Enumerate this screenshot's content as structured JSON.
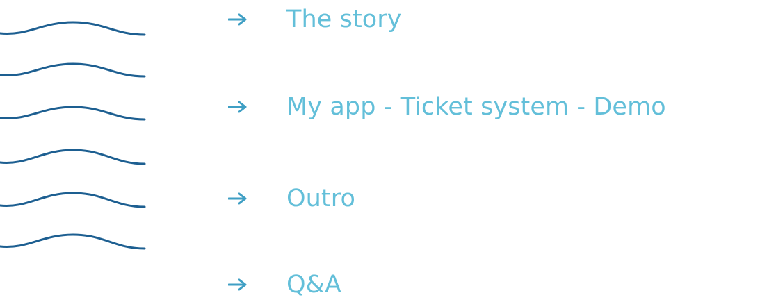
{
  "colors": {
    "wave": "#1d5f91",
    "text": "#63bfd9",
    "arrow": "#3f9fc4",
    "background": "#ffffff"
  },
  "decoration": {
    "wave_count": 6,
    "icon": "wave-lines"
  },
  "agenda": {
    "bullet_icon": "right-arrow-icon",
    "items": [
      {
        "label": "The story"
      },
      {
        "label": "My app - Ticket system - Demo"
      },
      {
        "label": "Outro"
      },
      {
        "label": "Q&A"
      }
    ]
  }
}
